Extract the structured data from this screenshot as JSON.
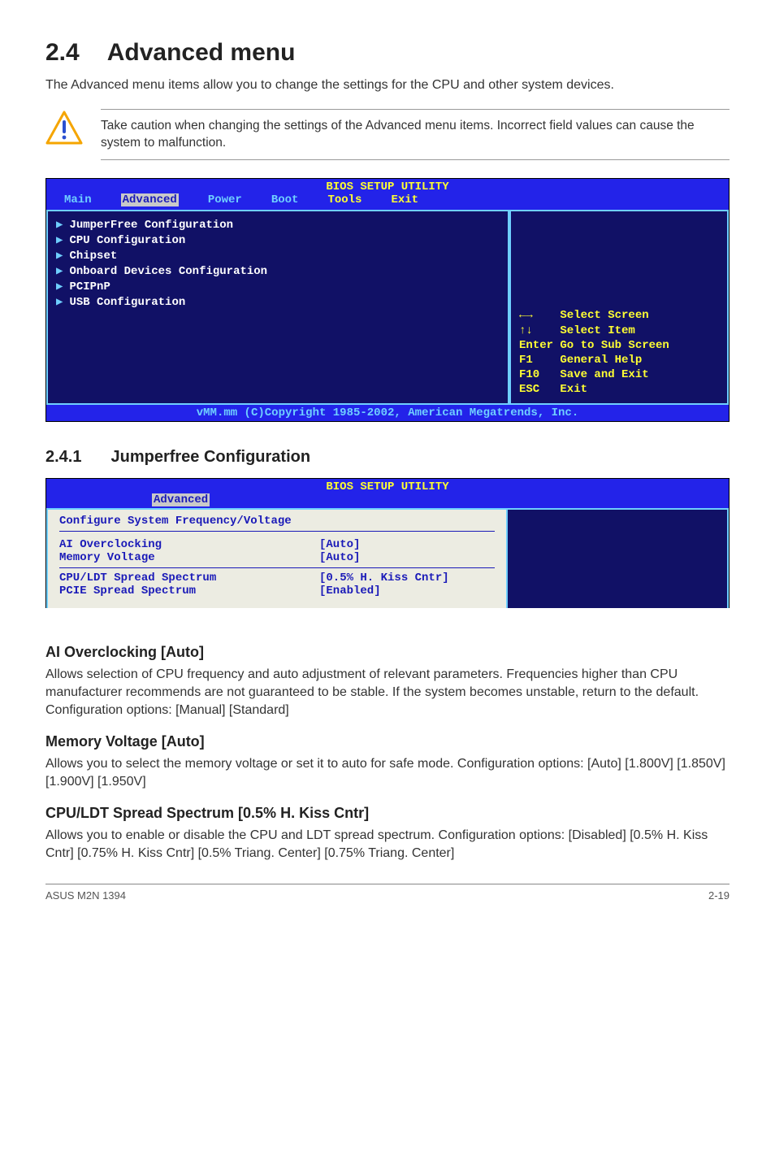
{
  "section": {
    "number": "2.4",
    "title": "Advanced menu"
  },
  "intro": "The Advanced menu items allow you to change the settings for the CPU and other system devices.",
  "caution": "Take caution when changing the settings of the Advanced menu items. Incorrect field values can cause the system to malfunction.",
  "bios1": {
    "title": "BIOS SETUP UTILITY",
    "tabs": [
      "Main",
      "Advanced",
      "Power",
      "Boot",
      "Tools",
      "Exit"
    ],
    "activeTab": 1,
    "items": [
      "JumperFree Configuration",
      "CPU Configuration",
      "Chipset",
      "Onboard Devices Configuration",
      "PCIPnP",
      "USB Configuration"
    ],
    "help": "←→    Select Screen\n↑↓    Select Item\nEnter Go to Sub Screen\nF1    General Help\nF10   Save and Exit\nESC   Exit",
    "footer": "vMM.mm (C)Copyright 1985-2002, American Megatrends, Inc."
  },
  "sub": {
    "number": "2.4.1",
    "title": "Jumperfree Configuration"
  },
  "bios2": {
    "title": "BIOS SETUP UTILITY",
    "tab": "Advanced",
    "groupTitle": "Configure System Frequency/Voltage",
    "rows": [
      {
        "label": "AI Overclocking",
        "value": "[Auto]"
      },
      {
        "label": "Memory Voltage",
        "value": "[Auto]"
      },
      {
        "label": "CPU/LDT Spread Spectrum",
        "value": "[0.5% H. Kiss Cntr]"
      },
      {
        "label": "PCIE Spread Spectrum",
        "value": "[Enabled]"
      }
    ]
  },
  "opts": [
    {
      "title": "AI Overclocking [Auto]",
      "body": "Allows selection of CPU frequency and auto adjustment of relevant parameters. Frequencies higher than CPU manufacturer recommends are not guaranteed to be stable. If the system becomes unstable, return to the default. Configuration options: [Manual] [Standard]"
    },
    {
      "title": "Memory Voltage [Auto]",
      "body": "Allows you to select the memory voltage or set it to auto for safe mode. Configuration options: [Auto] [1.800V] [1.850V] [1.900V] [1.950V]"
    },
    {
      "title": "CPU/LDT Spread Spectrum [0.5% H. Kiss Cntr]",
      "body": "Allows you to enable or disable the CPU and LDT spread spectrum. Configuration options: [Disabled] [0.5% H. Kiss Cntr] [0.75% H. Kiss Cntr] [0.5% Triang. Center] [0.75% Triang. Center]"
    }
  ],
  "footer": {
    "left": "ASUS M2N 1394",
    "right": "2-19"
  }
}
